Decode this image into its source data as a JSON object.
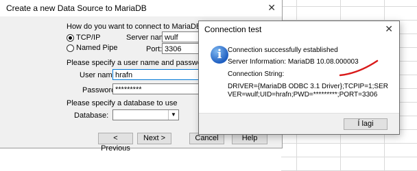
{
  "wizard": {
    "title": "Create a new Data Source to MariaDB",
    "close_glyph": "✕",
    "connect_prompt": "How do you want to connect to MariaDB",
    "tcpip_label": "TCP/IP",
    "named_pipe_label": "Named Pipe",
    "server_name_label": "Server name:",
    "server_name_value": "wulf",
    "port_label": "Port:",
    "port_value": "3306",
    "credentials_prompt": "Please specify a user name and password to connect to t",
    "user_name_label": "User name:",
    "user_name_value": "hrafn",
    "password_label": "Password:",
    "password_value": "*********",
    "database_prompt": "Please specify a database to use",
    "database_label": "Database:",
    "database_value": "",
    "buttons": {
      "previous": "< Previous",
      "next": "Next >",
      "cancel": "Cancel",
      "help": "Help"
    }
  },
  "connection_test": {
    "title": "Connection test",
    "close_glyph": "✕",
    "info_glyph": "i",
    "success": "Connection successfully established",
    "server_info": "Server Information: MariaDB 10.08.000003",
    "conn_string_label": "Connection String:",
    "conn_string_value": "DRIVER={MariaDB ODBC 3.1 Driver};TCPIP=1;SERVER=wulf;UID=hrafn;PWD=*********;PORT=3306",
    "ok_button": "Í lagi"
  },
  "annotation_color": "#d91a1a"
}
